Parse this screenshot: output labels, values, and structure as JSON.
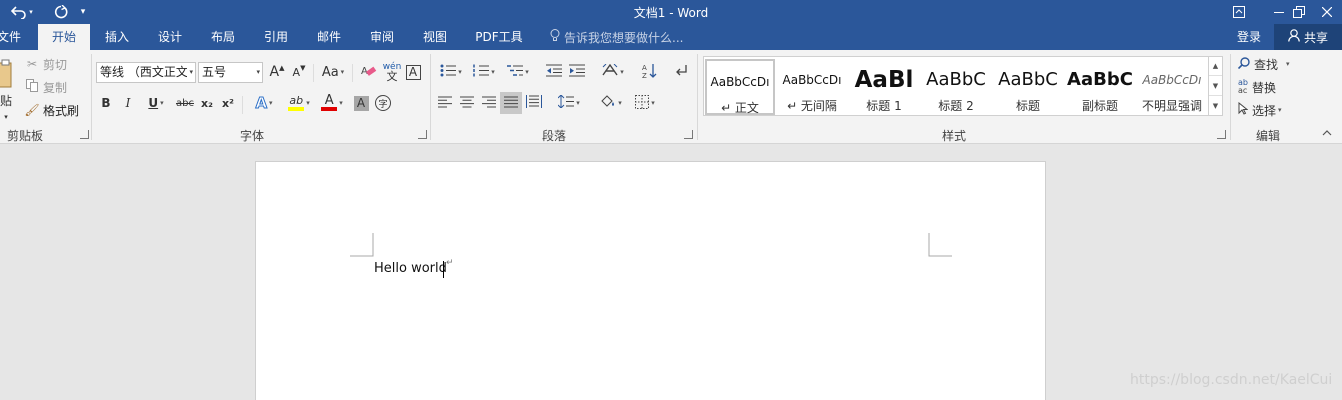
{
  "app": {
    "document_title": "文档1 - Word"
  },
  "quick_access": {
    "undo_icon": "undo-icon",
    "redo_icon": "redo-icon",
    "customize_icon": "customize-qat-icon"
  },
  "window_controls": [
    "ribbon-display-options-icon",
    "minimize-icon",
    "restore-icon",
    "close-icon"
  ],
  "tabs": [
    {
      "label": "文件"
    },
    {
      "label": "开始"
    },
    {
      "label": "插入"
    },
    {
      "label": "设计"
    },
    {
      "label": "布局"
    },
    {
      "label": "引用"
    },
    {
      "label": "邮件"
    },
    {
      "label": "审阅"
    },
    {
      "label": "视图"
    },
    {
      "label": "PDF工具"
    }
  ],
  "active_tab": "开始",
  "tell_me": {
    "text": "告诉我您想要做什么..."
  },
  "account": {
    "login": "登录",
    "share": "共享"
  },
  "clipboard": {
    "paste": "贴",
    "cut": "剪切",
    "copy": "复制",
    "format_painter": "格式刷",
    "group_label": "剪贴板"
  },
  "font": {
    "font_name": "等线 （西文正文",
    "font_size": "五号",
    "grow_label": "A",
    "shrink_label": "A",
    "case_label": "Aa",
    "bold": "B",
    "italic": "I",
    "underline": "U",
    "strikethrough": "abc",
    "subscript": "x₂",
    "superscript": "x²",
    "phonetic_top": "wén",
    "phonetic_bottom": "文",
    "char_border": "A",
    "text_effects": "A",
    "highlight": "ab",
    "font_color": "A",
    "char_shading": "A",
    "enclose": "字",
    "group_label": "字体",
    "highlight_color": "#ffff00",
    "font_color_value": "#e00000"
  },
  "paragraph": {
    "group_label": "段落"
  },
  "styles": {
    "items": [
      {
        "sample": "AaBbCcDı",
        "name": "↵ 正文"
      },
      {
        "sample": "AaBbCcDı",
        "name": "↵ 无间隔"
      },
      {
        "sample": "AaBl",
        "name": "标题 1"
      },
      {
        "sample": "AaBbC",
        "name": "标题 2"
      },
      {
        "sample": "AaBbC",
        "name": "标题"
      },
      {
        "sample": "AaBbC",
        "name": "副标题"
      },
      {
        "sample": "AaBbCcDı",
        "name": "不明显强调"
      }
    ],
    "group_label": "样式"
  },
  "editing": {
    "find": "查找",
    "replace": "替换",
    "select": "选择",
    "replace_icon_text": "ab​ac",
    "group_label": "编辑"
  },
  "document": {
    "text": "Hello world",
    "paragraph_mark": "↵"
  },
  "watermark": "https://blog.csdn.net/KaelCui",
  "colors": {
    "accent": "#2b579a",
    "ribbon_bg": "#f3f3f3",
    "canvas_bg": "#e6e6e6"
  }
}
